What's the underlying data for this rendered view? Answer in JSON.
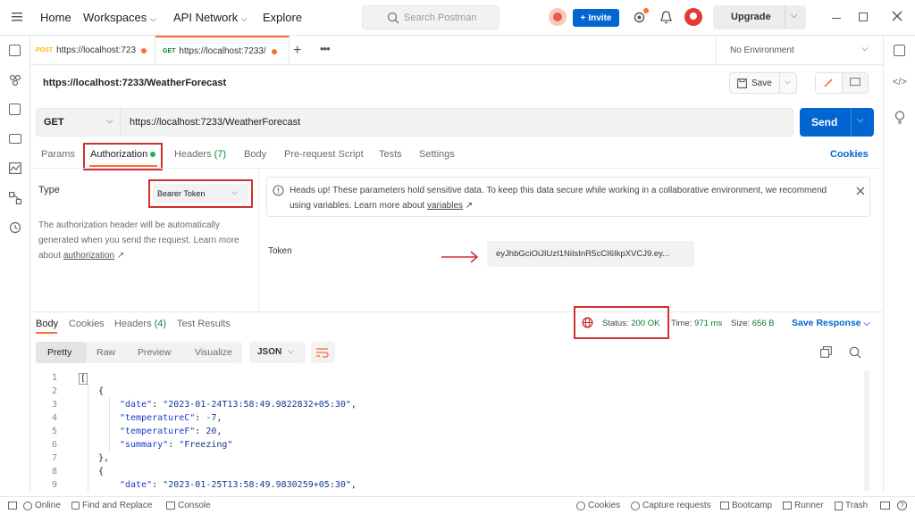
{
  "nav": {
    "home": "Home",
    "workspaces": "Workspaces",
    "api_network": "API Network",
    "explore": "Explore",
    "search_placeholder": "Search Postman",
    "invite": "Invite",
    "upgrade": "Upgrade"
  },
  "tabs": [
    {
      "method": "POST",
      "label": "https://localhost:723"
    },
    {
      "method": "GET",
      "label": "https://localhost:7233/"
    }
  ],
  "environment": "No Environment",
  "request": {
    "name": "https://localhost:7233/WeatherForecast",
    "save": "Save",
    "method": "GET",
    "url": "https://localhost:7233/WeatherForecast",
    "send": "Send"
  },
  "request_tabs": {
    "params": "Params",
    "authorization": "Authorization",
    "headers": "Headers",
    "headers_count": "(7)",
    "body": "Body",
    "pre_request": "Pre-request Script",
    "tests": "Tests",
    "settings": "Settings",
    "cookies": "Cookies"
  },
  "auth": {
    "type_label": "Type",
    "type_value": "Bearer Token",
    "description": "The authorization header will be automatically generated when you send the request. Learn more about",
    "link": "authorization",
    "notice_text": "Heads up! These parameters hold sensitive data. To keep this data secure while working in a collaborative environment, we recommend using variables. Learn more about",
    "notice_link": "variables",
    "token_label": "Token",
    "token_value": "eyJhbGciOiJIUzI1NiIsInR5cCI6IkpXVCJ9.ey..."
  },
  "response": {
    "tabs": {
      "body": "Body",
      "cookies": "Cookies",
      "headers": "Headers",
      "headers_count": "(4)",
      "results": "Test Results"
    },
    "status_label": "Status:",
    "status_value": "200 OK",
    "time_label": "Time:",
    "time_value": "971 ms",
    "size_label": "Size:",
    "size_value": "656 B",
    "save_response": "Save Response",
    "view_tabs": [
      "Pretty",
      "Raw",
      "Preview",
      "Visualize"
    ],
    "format": "JSON"
  },
  "code": {
    "line_numbers": [
      "1",
      "2",
      "3",
      "4",
      "5",
      "6",
      "7",
      "8",
      "9"
    ],
    "open_bracket": "[",
    "open_brace": "{",
    "close_brace": "},",
    "k_date": "\"date\"",
    "v_date1": "\"2023-01-24T13:58:49.9822832+05:30\"",
    "k_tempc": "\"temperatureC\"",
    "v_tempc": "-7",
    "k_tempf": "\"temperatureF\"",
    "v_tempf": "20",
    "k_summary": "\"summary\"",
    "v_summary": "\"Freezing\"",
    "v_date2": "\"2023-01-25T13:58:49.9830259+05:30\"",
    "colon": ": ",
    "comma": ","
  },
  "statusbar": {
    "online": "Online",
    "find_replace": "Find and Replace",
    "console": "Console",
    "cookies": "Cookies",
    "capture": "Capture requests",
    "bootcamp": "Bootcamp",
    "runner": "Runner",
    "trash": "Trash"
  },
  "colors": {
    "accent": "#0265d2",
    "orange": "#ff6c37",
    "red_highlight": "#d32f2f",
    "status_green": "#007f31"
  }
}
